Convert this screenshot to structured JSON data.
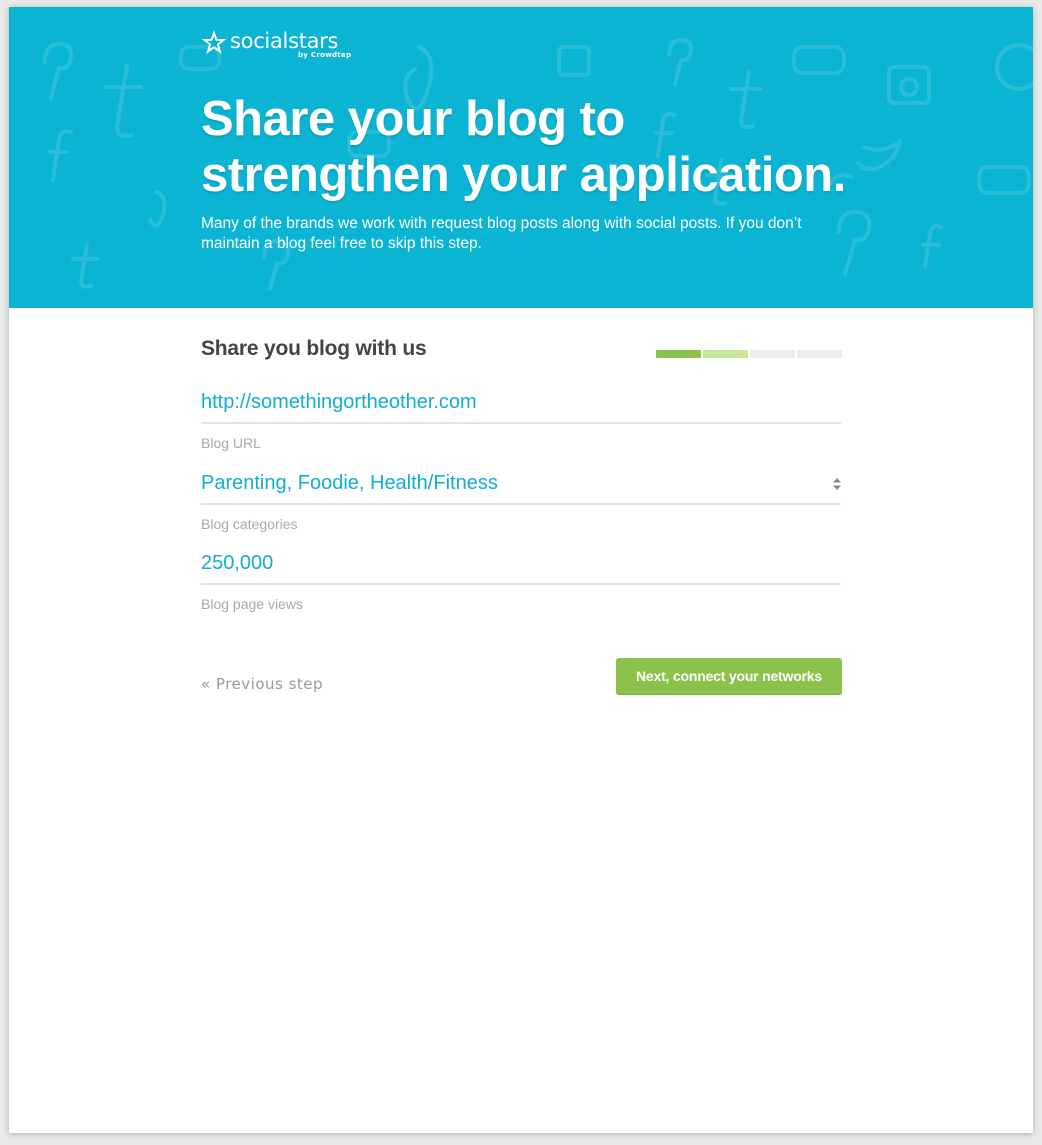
{
  "brand": {
    "name": "socialstars",
    "tagline": "by Crowdtap"
  },
  "hero": {
    "title_line1": "Share your blog to",
    "title_line2": "strengthen your application.",
    "subtitle": "Many of the brands we work with request blog posts along with social posts. If you don’t maintain a blog feel free to skip this step.",
    "background_color": "#0bb4d3"
  },
  "form": {
    "heading": "Share you blog with us",
    "progress": {
      "total_steps": 4,
      "current_step": 2,
      "colors": {
        "done": "#8bc34a",
        "current": "#c5e89a",
        "todo": "#ececec"
      }
    },
    "fields": {
      "blog_url": {
        "value": "http://somethingortheother.com",
        "label": "Blog URL"
      },
      "blog_categories": {
        "value": "Parenting, Foodie, Health/Fitness",
        "label": "Blog categories"
      },
      "blog_page_views": {
        "value": "250,000",
        "label": "Blog page views"
      }
    },
    "actions": {
      "previous_label": "« Previous step",
      "next_label": "Next, connect your networks"
    }
  }
}
